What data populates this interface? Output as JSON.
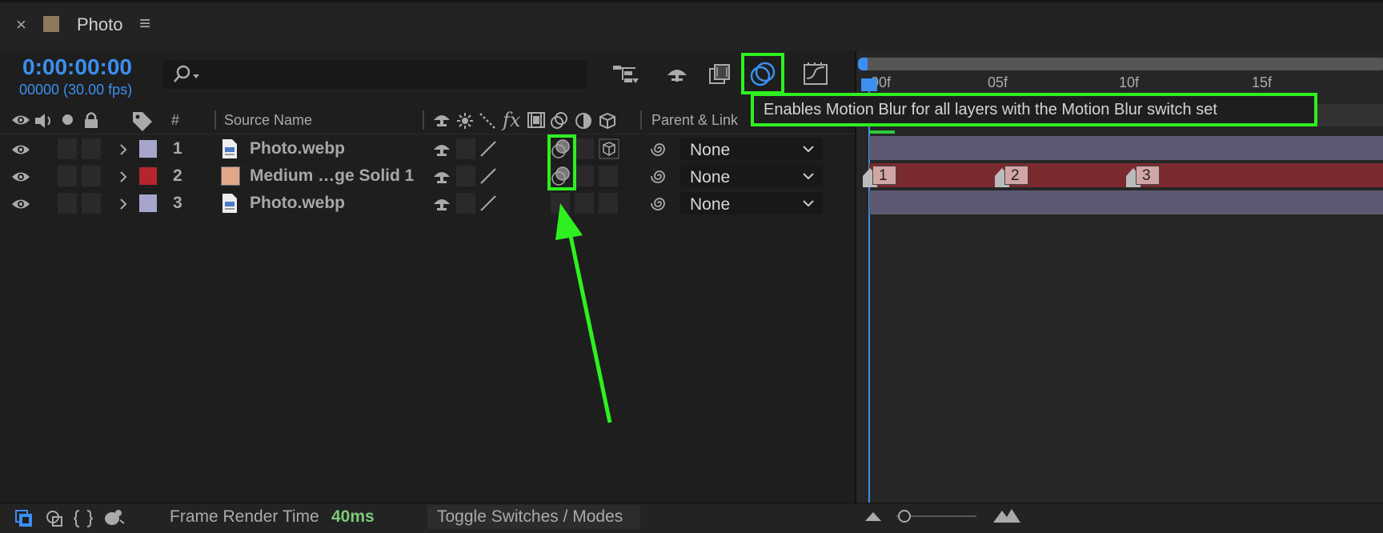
{
  "panel": {
    "close_glyph": "×",
    "title": "Photo",
    "menu_glyph": "≡"
  },
  "time": {
    "timecode": "0:00:00:00",
    "frames": "00000 (30.00 fps)"
  },
  "search": {
    "placeholder": ""
  },
  "columns": {
    "hash": "#",
    "source_name": "Source Name",
    "parent_link": "Parent & Link"
  },
  "layers": [
    {
      "num": "1",
      "name": "Photo.webp",
      "label_color": "#a6a6cc",
      "parent": "None"
    },
    {
      "num": "2",
      "name": "Medium …ge Solid 1",
      "label_color": "#b5262c",
      "parent": "None"
    },
    {
      "num": "3",
      "name": "Photo.webp",
      "label_color": "#a6a6cc",
      "parent": "None"
    }
  ],
  "ruler": {
    "labels": [
      "00f",
      "05f",
      "10f",
      "15f"
    ]
  },
  "keyframes": [
    "1",
    "2",
    "3"
  ],
  "tooltip": {
    "text": "Enables Motion Blur for all layers with the Motion Blur switch set"
  },
  "footer": {
    "render_label": "Frame Render Time",
    "render_value": "40ms",
    "toggle_label": "Toggle Switches / Modes"
  },
  "colors": {
    "accent_blue": "#3b8ff0",
    "highlight_green": "#2ef020",
    "render_green": "#7dc979",
    "track_purple": "#5c5a72",
    "track_red": "#7a2a2f"
  }
}
